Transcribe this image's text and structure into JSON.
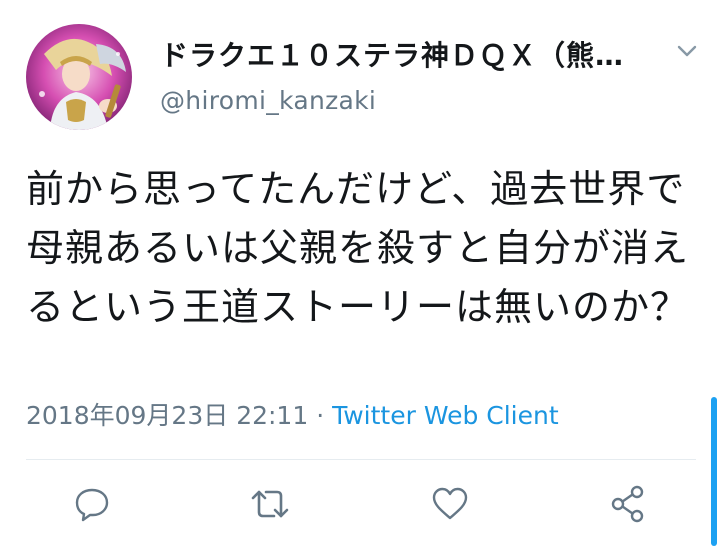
{
  "tweet": {
    "author": {
      "display_name": "ドラクエ１０ステラ神ＤＱＸ（熊…",
      "handle": "@hiromi_kanzaki",
      "avatar_icon": "avatar-image"
    },
    "menu_icon": "chevron-down-icon",
    "text": "前から思ってたんだけど、過去世界で母親あるいは父親を殺すと自分が消えるという王道ストーリーは無いのか？",
    "timestamp": "2018年09月23日 22:11",
    "separator": " · ",
    "client": "Twitter Web Client",
    "actions": {
      "reply_icon": "reply-icon",
      "retweet_icon": "retweet-icon",
      "like_icon": "heart-icon",
      "share_icon": "share-icon"
    }
  },
  "colors": {
    "text_primary": "#14171a",
    "text_secondary": "#657786",
    "link": "#1b95e0",
    "divider": "#e6ecf0",
    "scrollbar": "#1da1f2"
  }
}
